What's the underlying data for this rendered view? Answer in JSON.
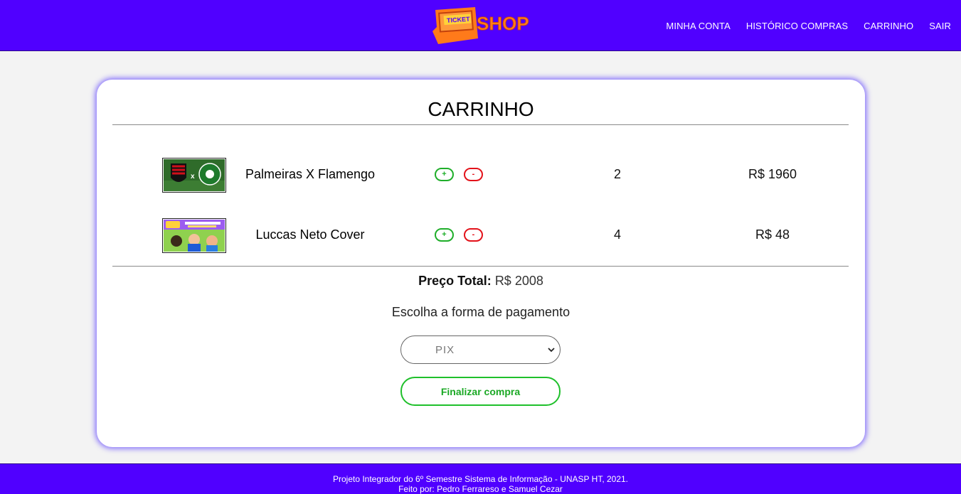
{
  "header": {
    "logo": {
      "badge_text": "TICKET",
      "word": "SHOP"
    },
    "nav": [
      "MINHA CONTA",
      "HISTÓRICO COMPRAS",
      "CARRINHO",
      "SAIR"
    ]
  },
  "cart": {
    "title": "CARRINHO",
    "items": [
      {
        "name": "Palmeiras X Flamengo",
        "plus": "+",
        "minus": "-",
        "qty": "2",
        "price": "R$ 1960"
      },
      {
        "name": "Luccas Neto Cover",
        "plus": "+",
        "minus": "-",
        "qty": "4",
        "price": "R$ 48"
      }
    ],
    "total_label": "Preço Total:",
    "total_value": "R$ 2008",
    "payment_label": "Escolha a forma de pagamento",
    "payment_selected": "PIX",
    "finish_label": "Finalizar compra"
  },
  "footer": {
    "line1": "Projeto Integrador do 6º Semestre Sistema de Informação - UNASP HT, 2021.",
    "made_by": "Feito por:",
    "author1": "Pedro Ferrareso",
    "and": "e",
    "author2": "Samuel Cezar"
  },
  "colors": {
    "brand": "#5000ff",
    "logo_orange": "#ff7a1a",
    "plus_green": "#1fae2a",
    "minus_red": "#e3121a"
  }
}
